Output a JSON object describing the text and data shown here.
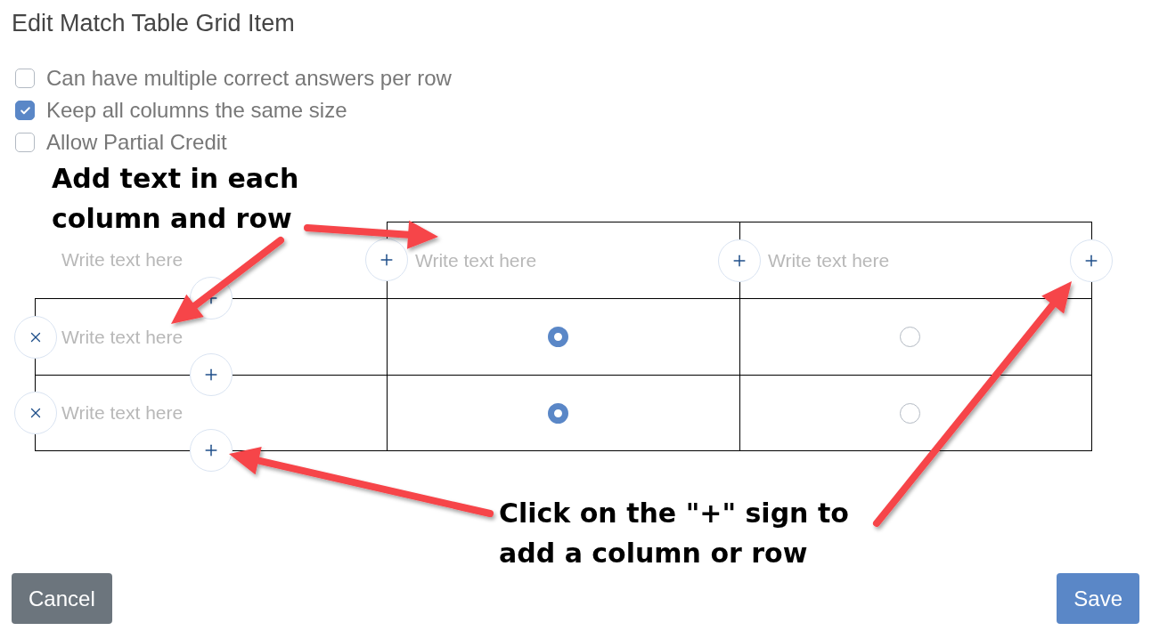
{
  "dialog": {
    "title": "Edit Match Table Grid Item"
  },
  "options": [
    {
      "label": "Can have multiple correct answers per row",
      "checked": false
    },
    {
      "label": "Keep all columns the same size",
      "checked": true
    },
    {
      "label": "Allow Partial Credit",
      "checked": false
    }
  ],
  "grid": {
    "columns": [
      {
        "placeholder": "Write text here"
      },
      {
        "placeholder": "Write text here"
      },
      {
        "placeholder": "Write text here"
      }
    ],
    "rows": [
      {
        "placeholder": "Write text here",
        "cells": [
          {
            "selected": true
          },
          {
            "selected": false
          }
        ]
      },
      {
        "placeholder": "Write text here",
        "cells": [
          {
            "selected": true
          },
          {
            "selected": false
          }
        ]
      }
    ]
  },
  "annotations": [
    {
      "text": "Add text in each column and row"
    },
    {
      "text": "Click on the \"+\" sign to add a column or row"
    }
  ],
  "buttons": [
    {
      "label": "Cancel",
      "kind": "secondary"
    },
    {
      "label": "Save",
      "kind": "primary"
    }
  ]
}
